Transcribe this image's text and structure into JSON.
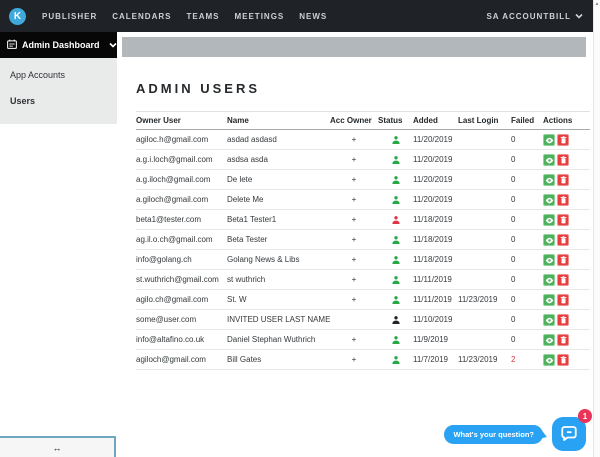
{
  "nav": {
    "logo_letter": "K",
    "items": [
      "PUBLISHER",
      "CALENDARS",
      "TEAMS",
      "MEETINGS",
      "NEWS"
    ],
    "sa_account": "SA ACCOUNT",
    "user": "BILL"
  },
  "sidebar": {
    "header_label": "Admin Dashboard",
    "items": [
      {
        "label": "App Accounts",
        "state": ""
      },
      {
        "label": "Users",
        "state": "active"
      }
    ],
    "collapse_icon": "↔"
  },
  "main": {
    "title": "ADMIN USERS",
    "table": {
      "columns": [
        "Owner User",
        "Name",
        "Acc Owner",
        "Status",
        "Added",
        "Last Login",
        "Failed",
        "Actions"
      ],
      "rows": [
        {
          "owner_user": "agiloc.h@gmail.com",
          "name": "asdad asdasd",
          "acc_owner": "+",
          "status": "green",
          "added": "11/20/2019",
          "last_login": "",
          "failed": "0",
          "failed_color": ""
        },
        {
          "owner_user": "a.g.i.loch@gmail.com",
          "name": "asdsa asda",
          "acc_owner": "+",
          "status": "green",
          "added": "11/20/2019",
          "last_login": "",
          "failed": "0",
          "failed_color": ""
        },
        {
          "owner_user": "a.g.iloch@gmail.com",
          "name": "De lete",
          "acc_owner": "+",
          "status": "green",
          "added": "11/20/2019",
          "last_login": "",
          "failed": "0",
          "failed_color": ""
        },
        {
          "owner_user": "a.giloch@gmail.com",
          "name": "Delete Me",
          "acc_owner": "+",
          "status": "green",
          "added": "11/20/2019",
          "last_login": "",
          "failed": "0",
          "failed_color": ""
        },
        {
          "owner_user": "beta1@tester.com",
          "name": "Beta1 Tester1",
          "acc_owner": "+",
          "status": "red",
          "added": "11/18/2019",
          "last_login": "",
          "failed": "0",
          "failed_color": ""
        },
        {
          "owner_user": "ag.il.o.ch@gmail.com",
          "name": "Beta Tester",
          "acc_owner": "+",
          "status": "green",
          "added": "11/18/2019",
          "last_login": "",
          "failed": "0",
          "failed_color": ""
        },
        {
          "owner_user": "info@golang.ch",
          "name": "Golang News & Libs",
          "acc_owner": "+",
          "status": "green",
          "added": "11/18/2019",
          "last_login": "",
          "failed": "0",
          "failed_color": ""
        },
        {
          "owner_user": "st.wuthrich@gmail.com",
          "name": "st wuthrich",
          "acc_owner": "+",
          "status": "green",
          "added": "11/11/2019",
          "last_login": "",
          "failed": "0",
          "failed_color": ""
        },
        {
          "owner_user": "agilo.ch@gmail.com",
          "name": "St. W",
          "acc_owner": "+",
          "status": "green",
          "added": "11/11/2019",
          "last_login": "11/23/2019",
          "failed": "0",
          "failed_color": ""
        },
        {
          "owner_user": "some@user.com",
          "name": "INVITED USER LAST NAME",
          "acc_owner": "",
          "status": "black",
          "added": "11/10/2019",
          "last_login": "",
          "failed": "0",
          "failed_color": ""
        },
        {
          "owner_user": "info@altafino.co.uk",
          "name": "Daniel Stephan Wuthrich",
          "acc_owner": "+",
          "status": "green",
          "added": "11/9/2019",
          "last_login": "",
          "failed": "0",
          "failed_color": ""
        },
        {
          "owner_user": "agiloch@gmail.com",
          "name": "Bill Gates",
          "acc_owner": "+",
          "status": "green",
          "added": "11/7/2019",
          "last_login": "11/23/2019",
          "failed": "2",
          "failed_color": "red"
        }
      ]
    }
  },
  "chat": {
    "tooltip": "What's your question?",
    "badge": "1"
  },
  "colors": {
    "nav_bg": "#1f2327",
    "logo_blue": "#3fa9dc",
    "header_gray_bar": "#b2b7bb",
    "status_green": "#28a745",
    "status_red": "#dc3545",
    "status_black": "#212529",
    "view_button_green": "#4db05b",
    "delete_button_red": "#e53e3e",
    "chat_blue": "#29a2f3",
    "badge_red": "#ea3457",
    "sidebar_accent_blue": "#6fa6c0"
  }
}
